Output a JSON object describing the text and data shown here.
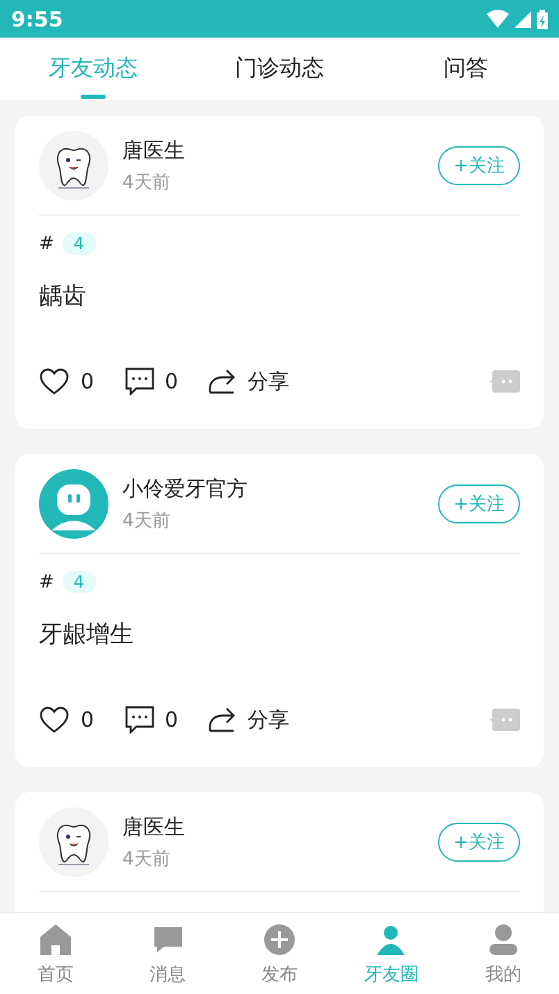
{
  "status_bar": {
    "time": "9:55"
  },
  "tabs": [
    {
      "label": "牙友动态",
      "selected": true
    },
    {
      "label": "门诊动态",
      "selected": false
    },
    {
      "label": "问答",
      "selected": false
    }
  ],
  "posts": [
    {
      "kind": "tooth",
      "author": "唐医生",
      "time": "4天前",
      "follow": "+关注",
      "hash": "#",
      "tag": "4",
      "content": "龋齿",
      "likes": "0",
      "comments": "0",
      "share": "分享"
    },
    {
      "kind": "robot",
      "author": "小伶爱牙官方",
      "time": "4天前",
      "follow": "+关注",
      "hash": "#",
      "tag": "4",
      "content": "牙龈增生",
      "likes": "0",
      "comments": "0",
      "share": "分享"
    },
    {
      "kind": "tooth",
      "author": "唐医生",
      "time": "4天前",
      "follow": "+关注"
    }
  ],
  "bottom_nav": [
    {
      "label": "首页",
      "kind": "home",
      "selected": false
    },
    {
      "label": "消息",
      "kind": "message",
      "selected": false
    },
    {
      "label": "发布",
      "kind": "plus",
      "selected": false
    },
    {
      "label": "牙友圈",
      "kind": "circle",
      "selected": true
    },
    {
      "label": "我的",
      "kind": "user",
      "selected": false
    }
  ]
}
